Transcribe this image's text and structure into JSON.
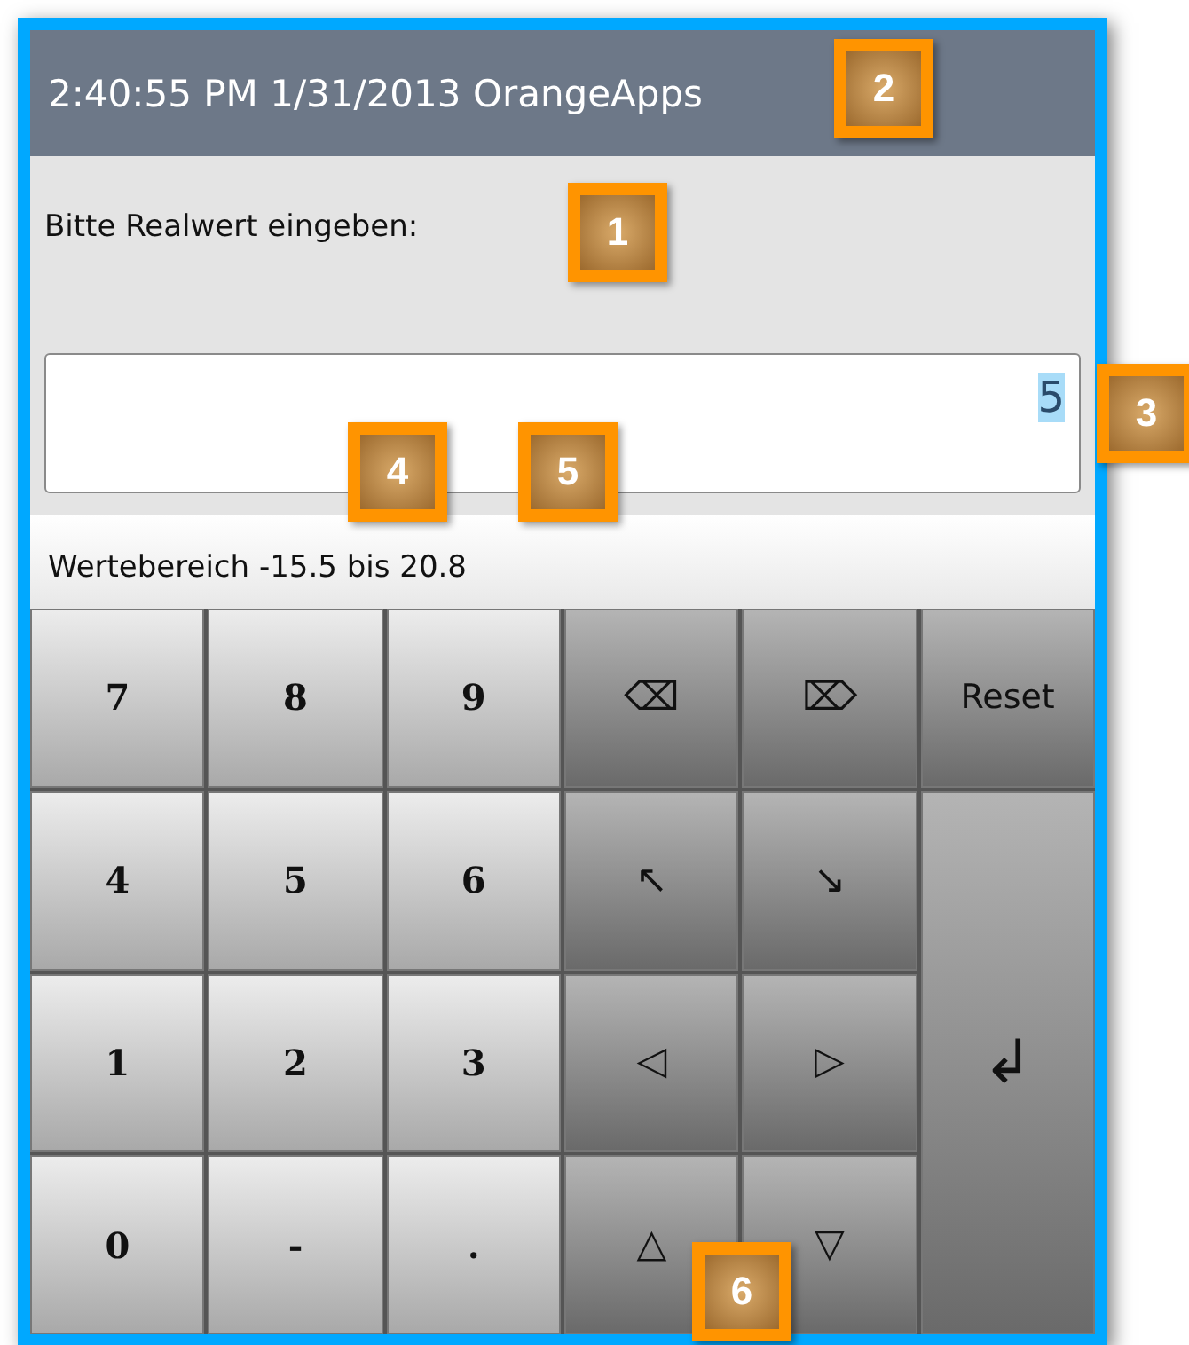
{
  "window": {
    "title": "2:40:55 PM 1/31/2013 OrangeApps"
  },
  "prompt": "Bitte Realwert eingeben:",
  "input": {
    "value": "5"
  },
  "range": "Wertebereich -15.5 bis 20.8",
  "keys": [
    {
      "kind": "digit",
      "label": "7"
    },
    {
      "kind": "digit",
      "label": "8"
    },
    {
      "kind": "digit",
      "label": "9"
    },
    {
      "kind": "action",
      "label": "⌫"
    },
    {
      "kind": "action",
      "label": "⌦"
    },
    {
      "kind": "action",
      "label": "Reset"
    },
    {
      "kind": "digit",
      "label": "4"
    },
    {
      "kind": "digit",
      "label": "5"
    },
    {
      "kind": "digit",
      "label": "6"
    },
    {
      "kind": "action",
      "label": "↖"
    },
    {
      "kind": "action",
      "label": "↘"
    },
    {
      "kind": "digit",
      "label": "1"
    },
    {
      "kind": "digit",
      "label": "2"
    },
    {
      "kind": "digit",
      "label": "3"
    },
    {
      "kind": "action",
      "label": "◁"
    },
    {
      "kind": "action",
      "label": "▷"
    },
    {
      "kind": "enter",
      "label": "↲"
    },
    {
      "kind": "digit",
      "label": "0"
    },
    {
      "kind": "digit",
      "label": "-"
    },
    {
      "kind": "digit",
      "label": "."
    },
    {
      "kind": "action",
      "label": "△"
    },
    {
      "kind": "action",
      "label": "▽"
    }
  ],
  "callouts": [
    "1",
    "2",
    "3",
    "4",
    "5",
    "6"
  ]
}
